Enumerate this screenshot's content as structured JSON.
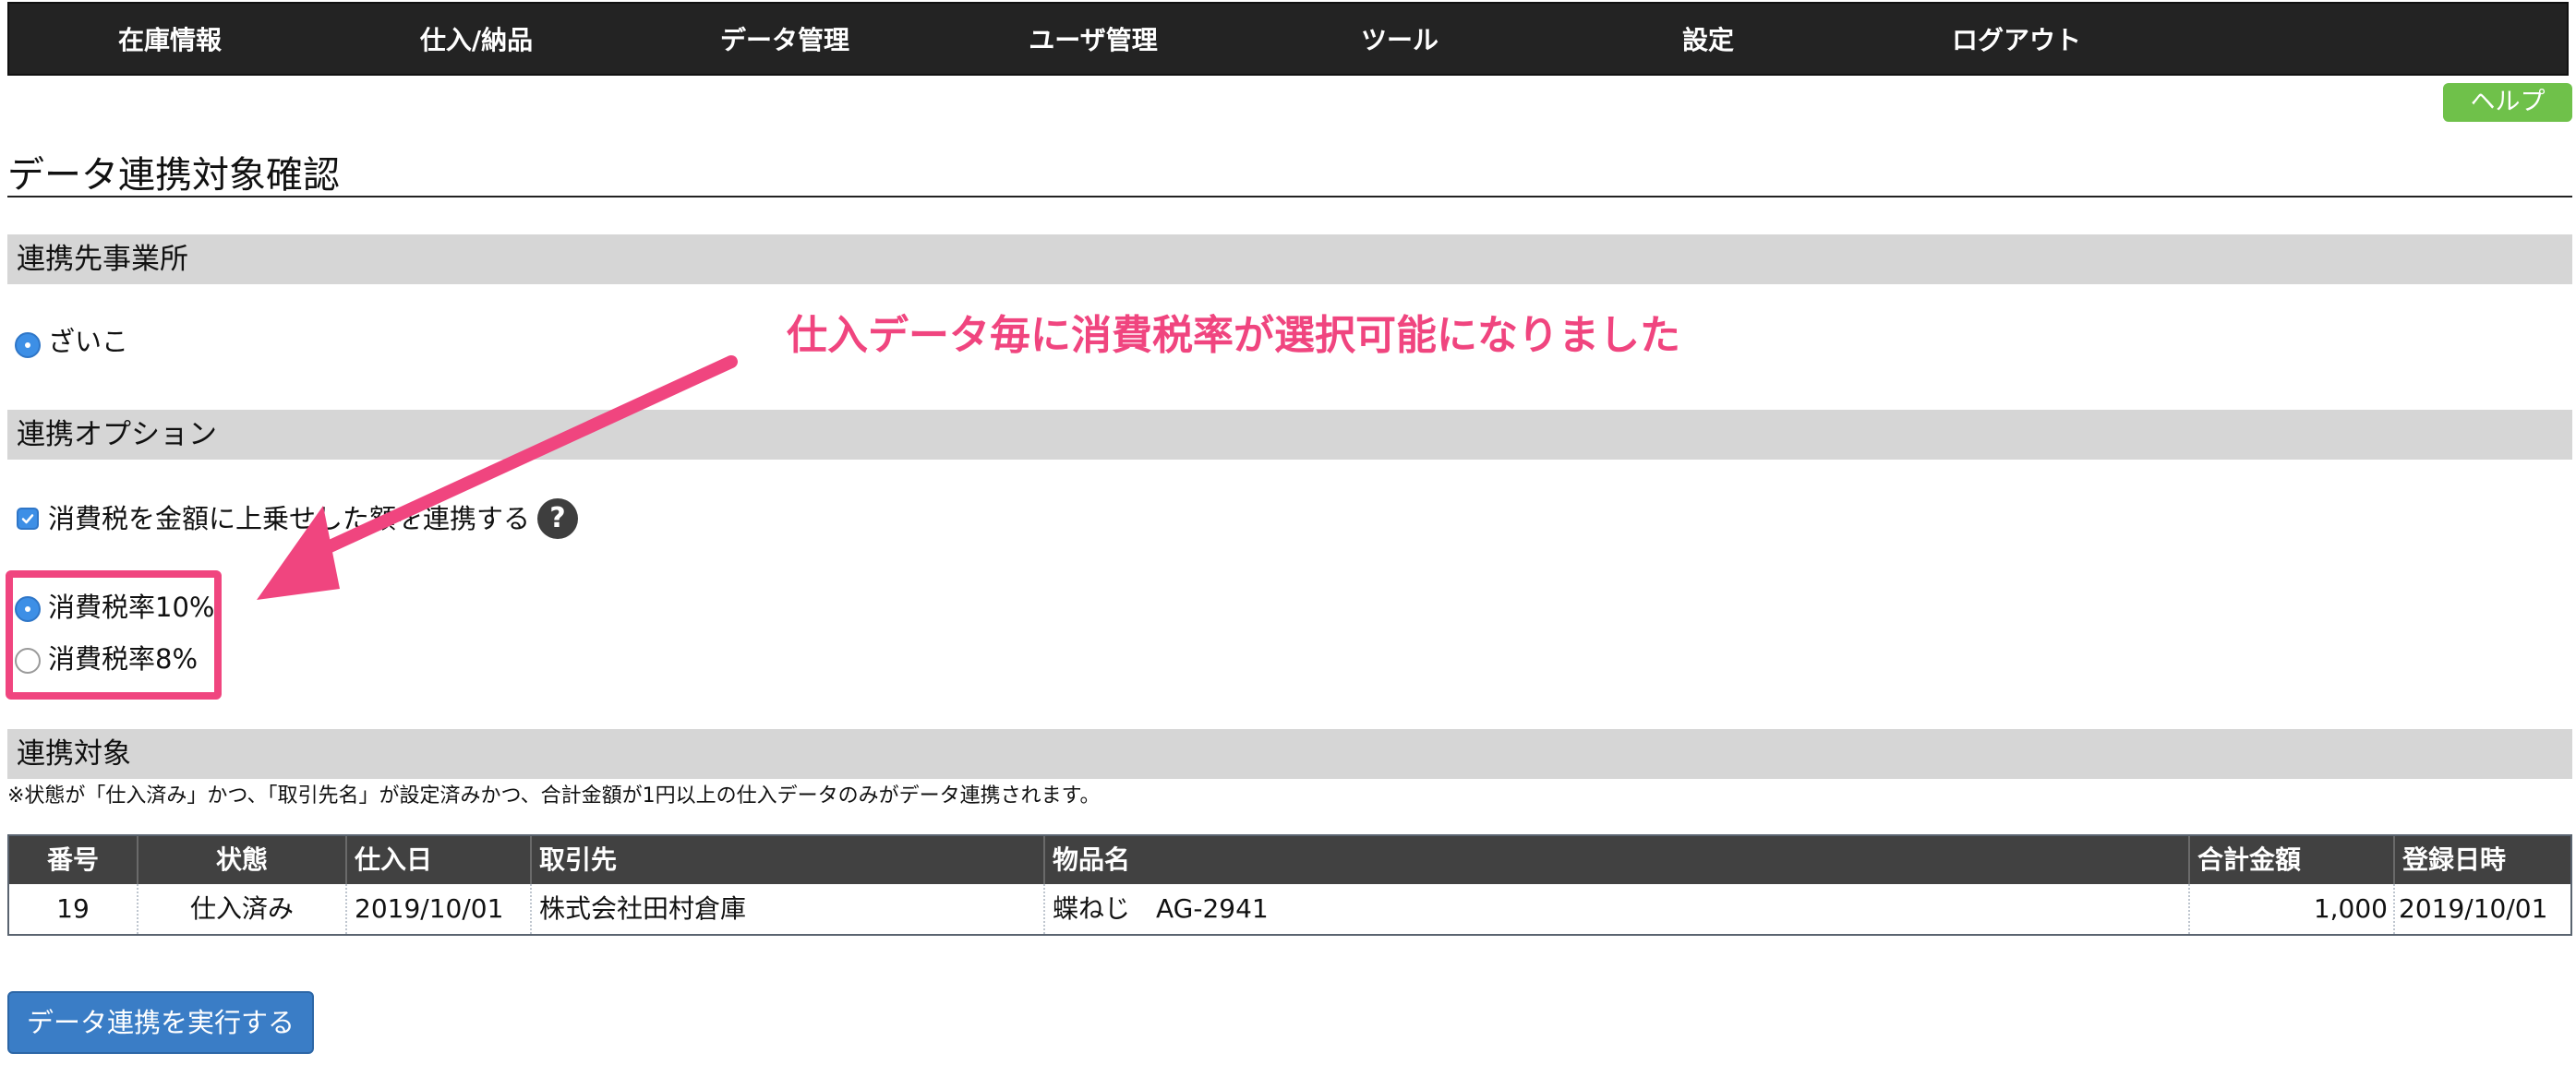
{
  "nav": {
    "items": [
      {
        "label": "在庫情報"
      },
      {
        "label": "仕入/納品"
      },
      {
        "label": "データ管理"
      },
      {
        "label": "ユーザ管理"
      },
      {
        "label": "ツール"
      },
      {
        "label": "設定"
      },
      {
        "label": "ログアウト"
      }
    ]
  },
  "help_label": "ヘルプ",
  "page_title": "データ連携対象確認",
  "sections": {
    "office": {
      "header": "連携先事業所",
      "options": [
        {
          "label": "ざいこ",
          "selected": true
        }
      ]
    },
    "options": {
      "header": "連携オプション",
      "tax_checkbox_label": "消費税を金額に上乗せした額を連携する",
      "tax_checkbox_checked": true,
      "help_icon_glyph": "?",
      "tax_rates": [
        {
          "label": "消費税率10%",
          "selected": true
        },
        {
          "label": "消費税率8%",
          "selected": false
        }
      ]
    },
    "targets": {
      "header": "連携対象",
      "note": "※状態が「仕入済み」かつ、「取引先名」が設定済みかつ、合計金額が1円以上の仕入データのみがデータ連携されます。",
      "columns": [
        "番号",
        "状態",
        "仕入日",
        "取引先",
        "物品名",
        "合計金額",
        "登録日時"
      ],
      "rows": [
        [
          "19",
          "仕入済み",
          "2019/10/01",
          "株式会社田村倉庫",
          "蝶ねじ　AG-2941",
          "1,000",
          "2019/10/01"
        ]
      ]
    }
  },
  "annotation": {
    "text": "仕入データ毎に消費税率が選択可能になりました",
    "color": "#f0457f"
  },
  "execute_button_label": "データ連携を実行する",
  "colors": {
    "nav_bg": "#232323",
    "help_bg": "#6fc14a",
    "section_bg": "#d6d6d6",
    "table_header_bg": "#414141",
    "primary_button": "#3a7dc6",
    "radio_checked": "#3d8fe6"
  },
  "icons": {
    "help": "question-circle-icon",
    "checkbox": "checkmark-icon",
    "arrow": "arrow-annotation-icon"
  }
}
